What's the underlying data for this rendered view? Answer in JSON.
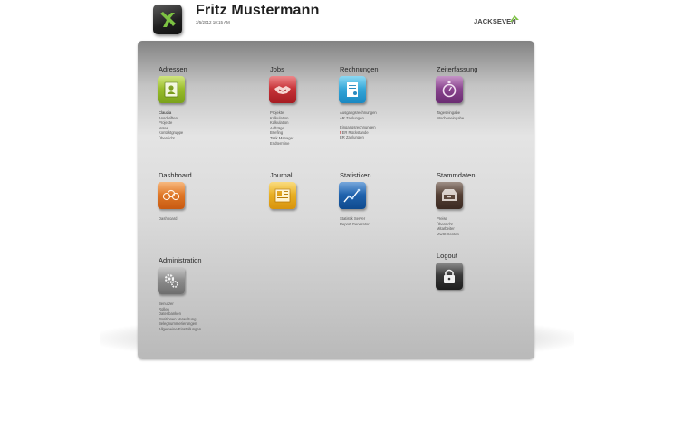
{
  "header": {
    "user_name": "Fritz Mustermann",
    "date": "3/5/2012 10:15 AM",
    "brand": "JACKSEVEN"
  },
  "sections": {
    "adressen": {
      "title": "Adressen",
      "icon": "address-card-icon",
      "color": "#8bb226",
      "links": [
        "Claudia",
        "Anschriften",
        "Projekte",
        "Notes",
        "Kontaktgruppe",
        "Übersicht"
      ]
    },
    "jobs": {
      "title": "Jobs",
      "icon": "handshake-icon",
      "color": "#c4282e",
      "links": [
        "Projekte",
        "Kalkulation",
        "Kalkulation",
        "Aufträge",
        "Briefing",
        "Task Manager",
        "Endtermine"
      ]
    },
    "rechnungen": {
      "title": "Rechnungen",
      "icon": "invoice-icon",
      "color": "#2ba4d8",
      "links": [
        "Ausgangsrechnungen",
        "AR Zahlungen"
      ],
      "links2": [
        "Eingangsrechnungen",
        "ER Rückstände",
        "ER Zahlungen"
      ]
    },
    "zeiterfassung": {
      "title": "Zeiterfassung",
      "icon": "stopwatch-icon",
      "color": "#86408a",
      "links": [
        "Tageseingabe",
        "Wocheneingabe"
      ]
    },
    "dashboard": {
      "title": "Dashboard",
      "icon": "gauges-icon",
      "color": "#e07424",
      "links": [
        "Dashboard"
      ]
    },
    "journal": {
      "title": "Journal",
      "icon": "journal-icon",
      "color": "#eab020",
      "links": []
    },
    "statistiken": {
      "title": "Statistiken",
      "icon": "line-chart-icon",
      "color": "#1f62ae",
      "links": [
        "Statistik Server",
        "Report Generator"
      ]
    },
    "stammdaten": {
      "title": "Stammdaten",
      "icon": "drawer-icon",
      "color": "#4f3c32",
      "links": [
        "Preise",
        "Übersicht",
        "Mitarbeiter",
        "MwSt Konten"
      ]
    },
    "administration": {
      "title": "Administration",
      "icon": "gears-icon",
      "color": "#8c8c8c",
      "links": [
        "Benutzer",
        "Rollen",
        "Datenbanken",
        "Positionen Verwaltung",
        "Belegnummerierungen",
        "Allgemeine Einstellungen"
      ]
    },
    "logout": {
      "title": "Logout",
      "icon": "padlock-icon",
      "color": "#333333"
    }
  }
}
